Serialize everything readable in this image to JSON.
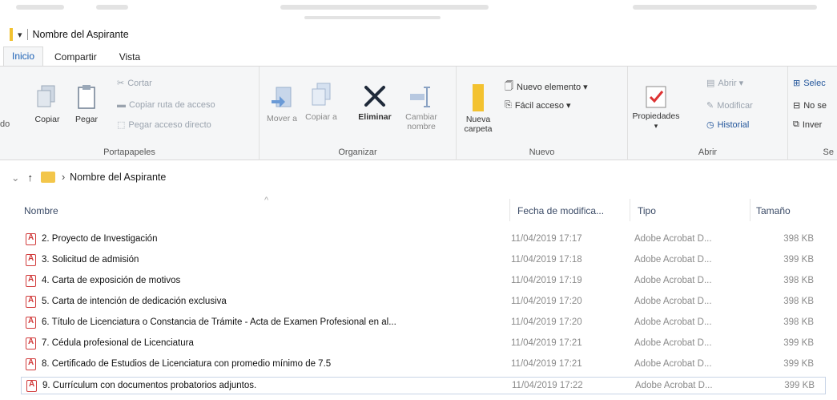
{
  "window": {
    "title": "Nombre del Aspirante"
  },
  "ribbon_tabs": [
    "Inicio",
    "Compartir",
    "Vista"
  ],
  "ribbon": {
    "portapapeles": {
      "label": "Portapapeles",
      "left_cut": "do",
      "copiar": "Copiar",
      "pegar": "Pegar",
      "cortar": "Cortar",
      "copiar_ruta": "Copiar ruta de acceso",
      "pegar_acceso": "Pegar acceso directo"
    },
    "organizar": {
      "label": "Organizar",
      "mover": "Mover a",
      "copiar": "Copiar a",
      "eliminar": "Eliminar",
      "cambiar": "Cambiar nombre"
    },
    "nuevo": {
      "label": "Nuevo",
      "nueva_carpeta": "Nueva carpeta",
      "nuevo_elemento": "Nuevo elemento ▾",
      "facil_acceso": "Fácil acceso ▾"
    },
    "abrir": {
      "label": "Abrir",
      "propiedades": "Propiedades",
      "abrir": "Abrir ▾",
      "modificar": "Modificar",
      "historial": "Historial"
    },
    "seleccionar": {
      "label": "Se",
      "sel_todo": "Selec",
      "no_sel": "No se",
      "invertir": "Inver"
    }
  },
  "address": {
    "path": "Nombre del Aspirante"
  },
  "columns": {
    "name": "Nombre",
    "date": "Fecha de modifica...",
    "type": "Tipo",
    "size": "Tamaño"
  },
  "files": [
    {
      "name": "2. Proyecto de Investigación",
      "date": "11/04/2019 17:17",
      "type": "Adobe Acrobat D...",
      "size": "398 KB"
    },
    {
      "name": "3. Solicitud de admisión",
      "date": "11/04/2019 17:18",
      "type": "Adobe Acrobat D...",
      "size": "399 KB"
    },
    {
      "name": "4. Carta de exposición de motivos",
      "date": "11/04/2019 17:19",
      "type": "Adobe Acrobat D...",
      "size": "398 KB"
    },
    {
      "name": "5. Carta de intención de dedicación exclusiva",
      "date": "11/04/2019 17:20",
      "type": "Adobe Acrobat D...",
      "size": "398 KB"
    },
    {
      "name": "6. Título de Licenciatura o Constancia de Trámite - Acta de Examen Profesional en al...",
      "date": "11/04/2019 17:20",
      "type": "Adobe Acrobat D...",
      "size": "398 KB"
    },
    {
      "name": "7. Cédula profesional de Licenciatura",
      "date": "11/04/2019 17:21",
      "type": "Adobe Acrobat D...",
      "size": "399 KB"
    },
    {
      "name": "8. Certificado de Estudios de Licenciatura con promedio mínimo de 7.5",
      "date": "11/04/2019 17:21",
      "type": "Adobe Acrobat D...",
      "size": "399 KB"
    },
    {
      "name": "9. Currículum con documentos probatorios adjuntos.",
      "date": "11/04/2019 17:22",
      "type": "Adobe Acrobat D...",
      "size": "399 KB"
    }
  ]
}
